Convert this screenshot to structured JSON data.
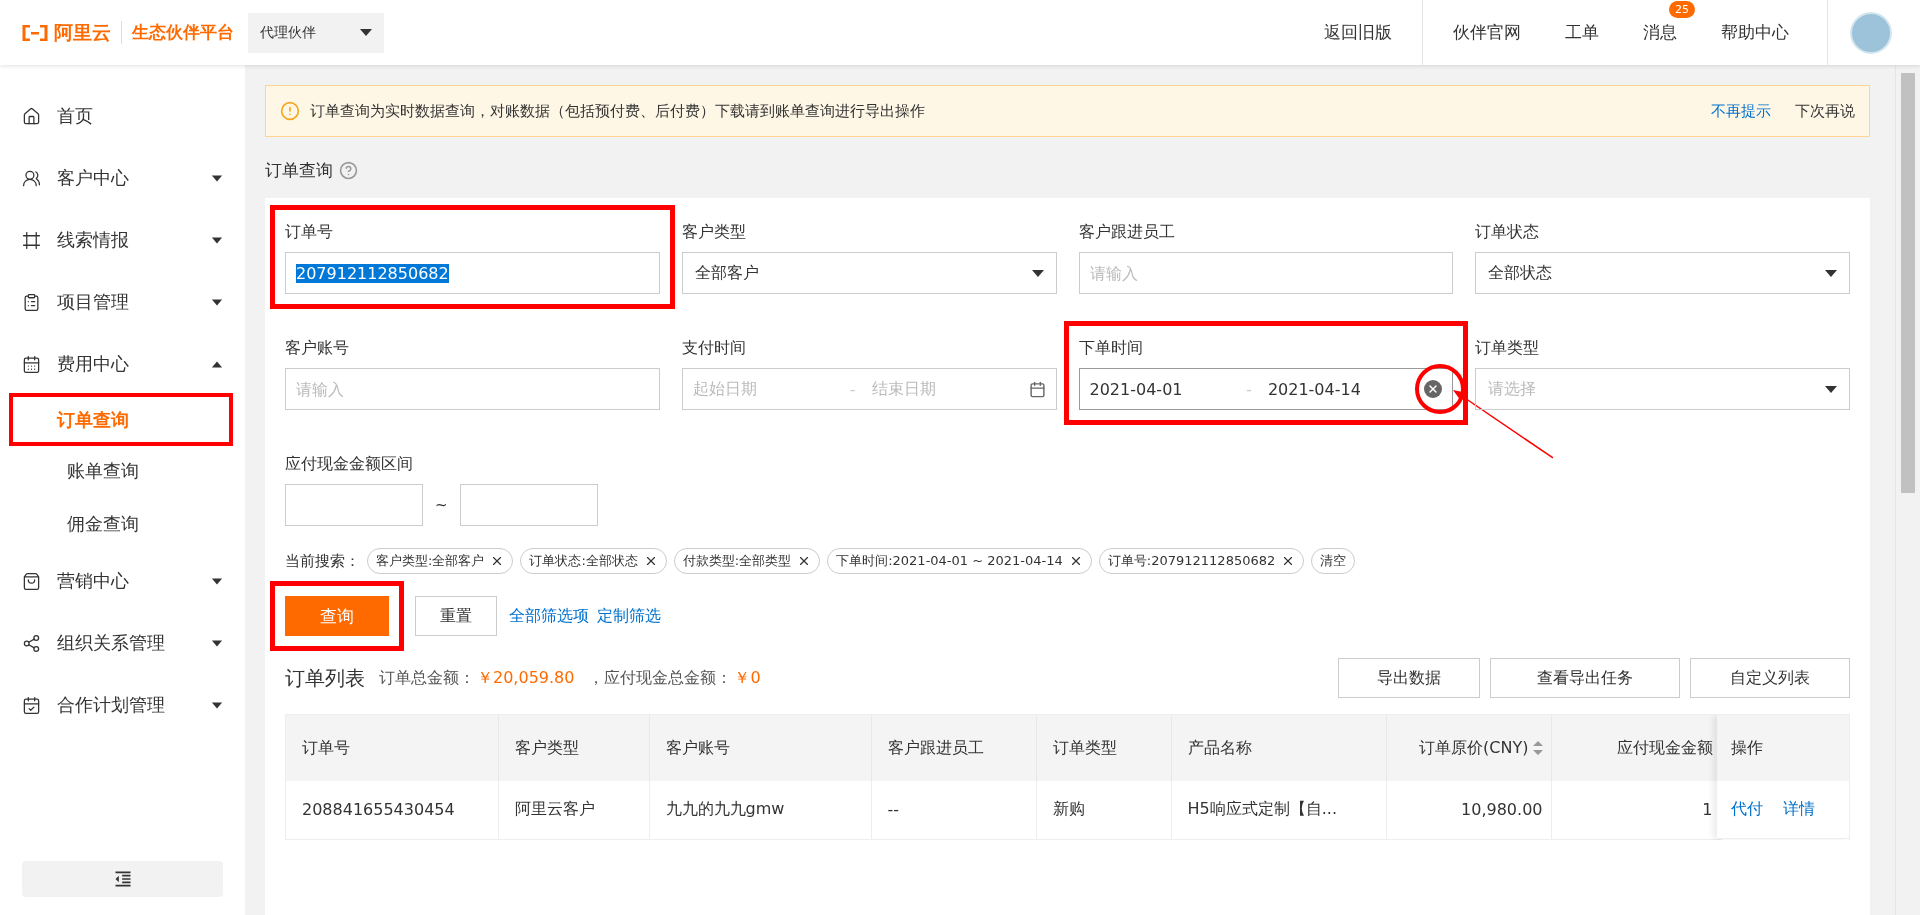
{
  "header": {
    "logo_text": "阿里云",
    "platform": "生态伙伴平台",
    "role_select": "代理伙伴",
    "back_link": "返回旧版",
    "nav": [
      {
        "label": "伙伴官网"
      },
      {
        "label": "工单"
      },
      {
        "label": "消息",
        "badge": "25"
      },
      {
        "label": "帮助中心"
      }
    ]
  },
  "sidebar": {
    "items": [
      {
        "label": "首页",
        "kind": "link"
      },
      {
        "label": "客户中心",
        "kind": "group",
        "expanded": false
      },
      {
        "label": "线索情报",
        "kind": "group",
        "expanded": false
      },
      {
        "label": "项目管理",
        "kind": "group",
        "expanded": false
      },
      {
        "label": "费用中心",
        "kind": "group",
        "expanded": true,
        "children": [
          {
            "label": "订单查询",
            "selected": true,
            "highlighted": true
          },
          {
            "label": "账单查询",
            "selected": false,
            "highlighted": false
          },
          {
            "label": "佣金查询",
            "selected": false,
            "highlighted": false
          }
        ]
      },
      {
        "label": "营销中心",
        "kind": "group",
        "expanded": false
      },
      {
        "label": "组织关系管理",
        "kind": "group",
        "expanded": false
      },
      {
        "label": "合作计划管理",
        "kind": "group",
        "expanded": false
      }
    ]
  },
  "notice": {
    "text": "订单查询为实时数据查询，对账数据（包括预付费、后付费）下载请到账单查询进行导出操作",
    "actions": [
      "不再提示",
      "下次再说"
    ]
  },
  "page_title": "订单查询",
  "filters": [
    {
      "label": "订单号",
      "kind": "input",
      "value": "207912112850682",
      "highlighted": true
    },
    {
      "label": "客户类型",
      "kind": "select",
      "value": "全部客户",
      "highlighted": false
    },
    {
      "label": "客户跟进员工",
      "kind": "input",
      "placeholder": "请输入",
      "highlighted": false
    },
    {
      "label": "订单状态",
      "kind": "select",
      "value": "全部状态",
      "highlighted": false
    },
    {
      "label": "客户账号",
      "kind": "input",
      "placeholder": "请输入",
      "highlighted": false
    },
    {
      "label": "支付时间",
      "kind": "date_range",
      "start_placeholder": "起始日期",
      "separator": "-",
      "end_placeholder": "结束日期",
      "highlighted": false
    },
    {
      "label": "下单时间",
      "kind": "date_range",
      "start": "2021-04-01",
      "separator": "-",
      "end": "2021-04-14",
      "highlighted": true,
      "clear_marked": true
    },
    {
      "label": "订单类型",
      "kind": "select",
      "placeholder": "请选择",
      "highlighted": false
    },
    {
      "label": "应付现金金额区间",
      "kind": "number_range",
      "separator": "~",
      "highlighted": false
    }
  ],
  "current_search": {
    "label": "当前搜索：",
    "tags": [
      "客户类型:全部客户",
      "订单状态:全部状态",
      "付款类型:全部类型",
      "下单时间:2021-04-01 ~ 2021-04-14",
      "订单号:207912112850682"
    ],
    "clear": "清空"
  },
  "query_button": {
    "label": "查询",
    "highlighted": true
  },
  "reset_button": "重置",
  "links": [
    "全部筛选项",
    "定制筛选"
  ],
  "orders": {
    "title": "订单列表",
    "summary": [
      {
        "label": "订单总金额：",
        "value": "￥20,059.80"
      },
      {
        "label": "，应付现金总金额：",
        "value": "￥0"
      }
    ],
    "actions": [
      "导出数据",
      "查看导出任务",
      "自定义列表"
    ],
    "columns": [
      {
        "label": "订单号",
        "kind": "text"
      },
      {
        "label": "客户类型",
        "kind": "text"
      },
      {
        "label": "客户账号",
        "kind": "text"
      },
      {
        "label": "客户跟进员工",
        "kind": "text"
      },
      {
        "label": "订单类型",
        "kind": "text"
      },
      {
        "label": "产品名称",
        "kind": "text"
      },
      {
        "label": "订单原价(CNY)",
        "kind": "amount",
        "sortable": true
      },
      {
        "label": "应付现金金额",
        "kind": "amount",
        "sortable": false
      }
    ],
    "action_column": "操作",
    "rows": [
      {
        "cells": [
          "208841655430454",
          "阿里云客户",
          "九九的九九gmw",
          "--",
          "新购",
          "H5响应式定制【自...",
          "10,980.00",
          "1"
        ],
        "actions": [
          "代付",
          "详情"
        ]
      }
    ]
  }
}
